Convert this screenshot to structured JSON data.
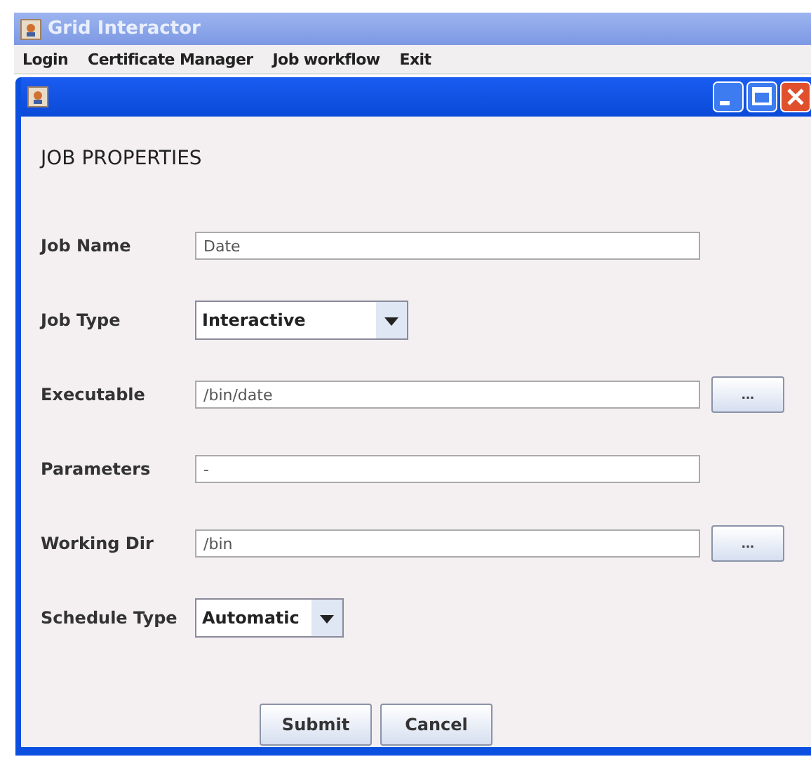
{
  "window": {
    "title": "Grid Interactor"
  },
  "menu": [
    "Login",
    "Certificate Manager",
    "Job workflow",
    "Exit"
  ],
  "frame": {
    "heading": "JOB PROPERTIES"
  },
  "fields": [
    {
      "label": "Job Name",
      "kind": "text",
      "value": "Date"
    },
    {
      "label": "Job Type",
      "kind": "dropdown",
      "value": "Interactive"
    },
    {
      "label": "Executable",
      "kind": "text",
      "value": "/bin/date",
      "browse": "..."
    },
    {
      "label": "Parameters",
      "kind": "text",
      "value": "-"
    },
    {
      "label": "Working Dir",
      "kind": "text",
      "value": "/bin",
      "browse": "..."
    },
    {
      "label": "Schedule Type",
      "kind": "dropdown",
      "value": "Automatic"
    }
  ],
  "buttons": [
    "Submit",
    "Cancel"
  ]
}
